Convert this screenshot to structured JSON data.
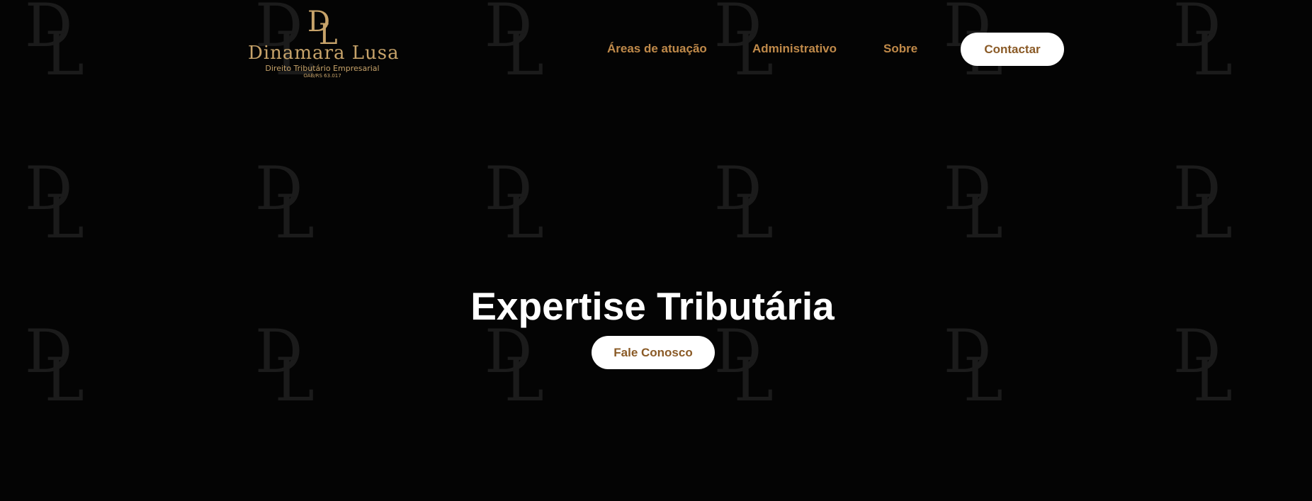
{
  "brand": {
    "monogram": "DL",
    "name": "Dinamara Lusa",
    "tagline": "Direito Tributário Empresarial",
    "registration": "OAB/RS 63.017",
    "accent_color": "#c7a36a"
  },
  "nav": {
    "links": [
      {
        "label": "Áreas de atuação"
      },
      {
        "label": "Administrativo"
      },
      {
        "label": "Sobre"
      }
    ],
    "cta_label": "Contactar",
    "link_color": "#c08a4a"
  },
  "hero": {
    "title": "Expertise Tributária",
    "cta_label": "Fale Conosco"
  },
  "background": {
    "pattern_icon": "dl-monogram-icon",
    "color": "#040404"
  }
}
